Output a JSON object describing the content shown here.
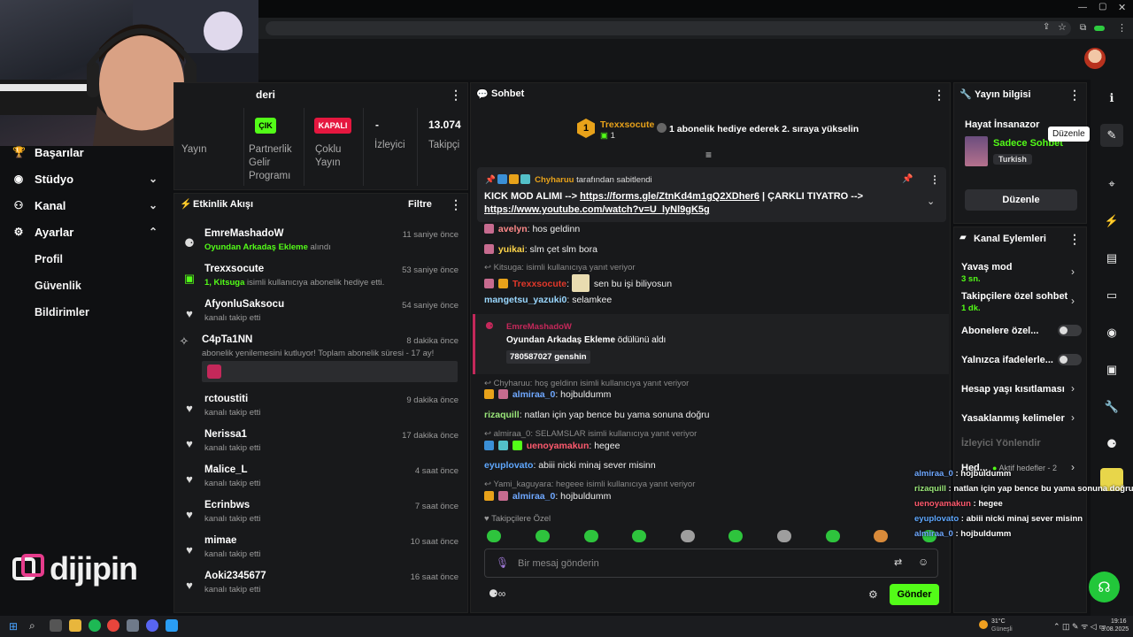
{
  "sidebar": {
    "items": [
      {
        "label": "Başarılar",
        "icon": "trophy-icon"
      },
      {
        "label": "Stüdyo",
        "icon": "studio-icon"
      },
      {
        "label": "Kanal",
        "icon": "channel-icon"
      },
      {
        "label": "Ayarlar",
        "icon": "gear-icon"
      }
    ],
    "sub_items": [
      "Profil",
      "Güvenlik",
      "Bildirimler"
    ],
    "logo_text": "dijipin"
  },
  "stats_panel": {
    "title": "deri",
    "stats": [
      {
        "value": "ÇIK",
        "label": "Yayın"
      },
      {
        "value": "",
        "label": "Partnerlik Gelir Programı"
      },
      {
        "value": "KAPALI",
        "label": "Çoklu Yayın"
      },
      {
        "value": "-",
        "label": "İzleyici"
      },
      {
        "value": "13.074",
        "label": "Takipçi"
      }
    ]
  },
  "activity": {
    "title": "Etkinlik Akışı",
    "filter_label": "Filtre",
    "items": [
      {
        "name": "EmreMashadoW",
        "sub_highlight": "Oyundan Arkadaş Ekleme",
        "sub": "alındı",
        "time": "11 saniye önce",
        "icon": "reward-icon"
      },
      {
        "name": "Trexxsocute",
        "sub_highlight": "1, Kitsuga",
        "sub": "isimli kullanıcıya abonelik hediye etti.",
        "time": "53 saniye önce",
        "icon": "gift-icon"
      },
      {
        "name": "AfyonluSaksocu",
        "sub_highlight": "",
        "sub": "kanalı takip etti",
        "time": "54 saniye önce",
        "icon": "heart-icon"
      },
      {
        "name": "C4pTa1NN",
        "sub_highlight": "",
        "sub": "abonelik yenilemesini kutluyor! Toplam abonelik süresi - 17 ay!",
        "time": "8 dakika önce",
        "icon": "star-icon"
      },
      {
        "name": "rctoustiti",
        "sub_highlight": "",
        "sub": "kanalı takip etti",
        "time": "9 dakika önce",
        "icon": "heart-icon"
      },
      {
        "name": "Nerissa1",
        "sub_highlight": "",
        "sub": "kanalı takip etti",
        "time": "17 dakika önce",
        "icon": "heart-icon"
      },
      {
        "name": "Malice_L",
        "sub_highlight": "",
        "sub": "kanalı takip etti",
        "time": "4 saat önce",
        "icon": "heart-icon"
      },
      {
        "name": "Ecrinbws",
        "sub_highlight": "",
        "sub": "kanalı takip etti",
        "time": "7 saat önce",
        "icon": "heart-icon"
      },
      {
        "name": "mimae",
        "sub_highlight": "",
        "sub": "kanalı takip etti",
        "time": "10 saat önce",
        "icon": "heart-icon"
      },
      {
        "name": "Aoki2345677",
        "sub_highlight": "",
        "sub": "kanalı takip etti",
        "time": "16 saat önce",
        "icon": "heart-icon"
      }
    ]
  },
  "chat": {
    "title": "Sohbet",
    "gift_user": "Trexxsocute",
    "gift_count": "1",
    "gift_promo": "1 abonelik hediye ederek 2. sıraya yükselin",
    "pinned_by": "Chyharuu",
    "pinned_by_suffix": "tarafından sabitlendi",
    "pinned_text_1": "KICK MOD ALIMI --> ",
    "pinned_link_1": "https://forms.gle/ZtnKd4m1gQ2XDher6",
    "pinned_text_2": " | ÇARKLI TIYATRO --> ",
    "pinned_link_2": "https://www.youtube.com/watch?v=U_lyNl9gK5g",
    "messages": [
      {
        "user": "avelyn",
        "text": "hos geldinn",
        "color": "#ff8a8a"
      },
      {
        "user": "yuikai",
        "text": "slm çet slm bora",
        "color": "#ffd54a"
      },
      {
        "reply": "Kitsuga: isimli kullanıcıya yanıt veriyor"
      },
      {
        "user": "Trexxsocute",
        "text": "sen bu işi biliyosun",
        "color": "#e2382a"
      },
      {
        "user": "mangetsu_yazuki0",
        "text": "selamkee",
        "color": "#9ad8ff"
      },
      {
        "reply": "Chyharuu: hoş geldinn isimli kullanıcıya yanıt veriyor"
      },
      {
        "user": "almiraa_0",
        "text": "hojbuldumm",
        "color": "#6fa8ff"
      },
      {
        "user": "rizaquill",
        "text": "natlan için yap bence bu yama sonuna doğru",
        "color": "#9be87a"
      },
      {
        "reply": "almiraa_0: SELAMSLAR isimli kullanıcıya yanıt veriyor"
      },
      {
        "user": "uenoyamakun",
        "text": "hegee",
        "color": "#ff5a6e"
      },
      {
        "user": "eyuplovato",
        "text": "abiii nicki minaj sever misinn",
        "color": "#5fa8ff"
      },
      {
        "reply": "Yami_kaguyara: hegeee isimli kullanıcıya yanıt veriyor"
      },
      {
        "user": "almiraa_0",
        "text": "hojbuldumm",
        "color": "#6fa8ff"
      }
    ],
    "reward": {
      "user": "EmreMashadoW",
      "title": "Oyundan Arkadaş Ekleme",
      "suffix": "ödülünü aldı",
      "input": "780587027 genshin"
    },
    "followers_only": "Takipçilere Özel",
    "input_placeholder": "Bir mesaj gönderin",
    "send_label": "Gönder"
  },
  "stream_info": {
    "title": "Yayın bilgisi",
    "stream_title": "Hayat İnsanazor",
    "category": "Sadece Sohbet",
    "language": "Turkish",
    "edit_label": "Düzenle",
    "tooltip": "Düzenle"
  },
  "channel_actions": {
    "title": "Kanal Eylemleri",
    "items": [
      {
        "label": "Yavaş mod",
        "sub": "3 sn."
      },
      {
        "label": "Takipçilere özel sohbet",
        "sub": "1 dk."
      },
      {
        "label": "Abonelere özel...",
        "sub": ""
      },
      {
        "label": "Yalnızca ifadelerle...",
        "sub": ""
      },
      {
        "label": "Hesap yaşı kısıtlaması",
        "sub": ""
      },
      {
        "label": "Yasaklanmış kelimeler",
        "sub": ""
      },
      {
        "label": "İzleyici Yönlendir",
        "sub": ""
      },
      {
        "label": "Hed...",
        "sub": ""
      }
    ],
    "goals_label": "Aktif hedefler - 2"
  },
  "overlay_chat": [
    {
      "user": "almiraa_0",
      "text": "hojbuldumm",
      "color": "#6fa8ff"
    },
    {
      "user": "rizaquill",
      "text": "natlan için yap bence bu yama sonuna doğru",
      "color": "#9be87a"
    },
    {
      "user": "uenoyamakun",
      "text": "hegee",
      "color": "#ff5a6e"
    },
    {
      "user": "eyuplovato",
      "text": "abiii nicki minaj sever misinn",
      "color": "#5fa8ff"
    },
    {
      "user": "almiraa_0",
      "text": "hojbuldumm",
      "color": "#6fa8ff"
    }
  ],
  "taskbar": {
    "weather": "31°C",
    "weather_sub": "Güneşli",
    "time": "19:16",
    "date": "3.08.2025"
  },
  "colors": {
    "accent": "#53fc18",
    "danger": "#e5173f",
    "panel": "#18191b",
    "background": "#0f1012"
  }
}
